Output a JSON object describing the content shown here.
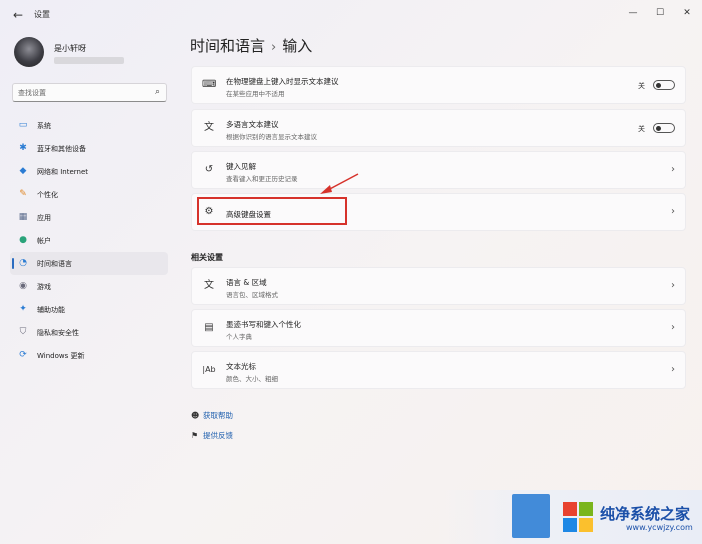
{
  "window": {
    "title": "设置",
    "back_icon": "arrow-left-icon",
    "controls": [
      "minimize",
      "maximize",
      "close"
    ]
  },
  "user": {
    "name": "是小轩呀",
    "email": ""
  },
  "search": {
    "placeholder": "查找设置",
    "icon": "search-icon"
  },
  "sidebar": {
    "items": [
      {
        "label": "系统",
        "icon": "monitor-icon",
        "color": "#2b7cd3"
      },
      {
        "label": "蓝牙和其他设备",
        "icon": "bluetooth-icon",
        "color": "#2b7cd3"
      },
      {
        "label": "网络和 Internet",
        "icon": "wifi-icon",
        "color": "#2b7cd3"
      },
      {
        "label": "个性化",
        "icon": "brush-icon",
        "color": "#e08a2b"
      },
      {
        "label": "应用",
        "icon": "apps-icon",
        "color": "#5a6b8c"
      },
      {
        "label": "帐户",
        "icon": "account-icon",
        "color": "#2aa37a"
      },
      {
        "label": "时间和语言",
        "icon": "globe-clock-icon",
        "color": "#2b7cd3",
        "active": true
      },
      {
        "label": "游戏",
        "icon": "gamepad-icon",
        "color": "#6a6a7a"
      },
      {
        "label": "辅助功能",
        "icon": "accessibility-icon",
        "color": "#2b7cd3"
      },
      {
        "label": "隐私和安全性",
        "icon": "shield-icon",
        "color": "#6a6a7a"
      },
      {
        "label": "Windows 更新",
        "icon": "update-icon",
        "color": "#2b7cd3"
      }
    ]
  },
  "main": {
    "breadcrumb_parent": "时间和语言",
    "breadcrumb_sep": "›",
    "breadcrumb_current": "输入",
    "cards": [
      {
        "title": "在物理键盘上键入时显示文本建议",
        "subtitle": "在某些应用中不适用",
        "icon": "keyboard-icon",
        "toggle_label": "关",
        "toggle_on": false
      },
      {
        "title": "多语言文本建议",
        "subtitle": "根据你识别的语言显示文本建议",
        "icon": "language-icon",
        "toggle_label": "关",
        "toggle_on": false
      },
      {
        "title": "键入见解",
        "subtitle": "查看键入和更正历史记录",
        "icon": "history-icon"
      },
      {
        "title": "高级键盘设置",
        "subtitle": "",
        "icon": "gear-icon",
        "highlighted": true
      }
    ],
    "related_label": "相关设置",
    "related_cards": [
      {
        "title": "语言 & 区域",
        "subtitle": "语言包、区域格式",
        "icon": "language-icon"
      },
      {
        "title": "墨迹书写和键入个性化",
        "subtitle": "个人字典",
        "icon": "notebook-icon"
      },
      {
        "title": "文本光标",
        "subtitle": "颜色、大小、粗细",
        "icon": "text-cursor-icon"
      }
    ],
    "footer_links": [
      {
        "label": "获取帮助",
        "icon": "help-chat-icon"
      },
      {
        "label": "提供反馈",
        "icon": "feedback-icon"
      }
    ],
    "annotation_color": "#d6322b"
  },
  "watermark": {
    "text": "纯净系统之家",
    "url": "www.ycwjzy.com"
  }
}
